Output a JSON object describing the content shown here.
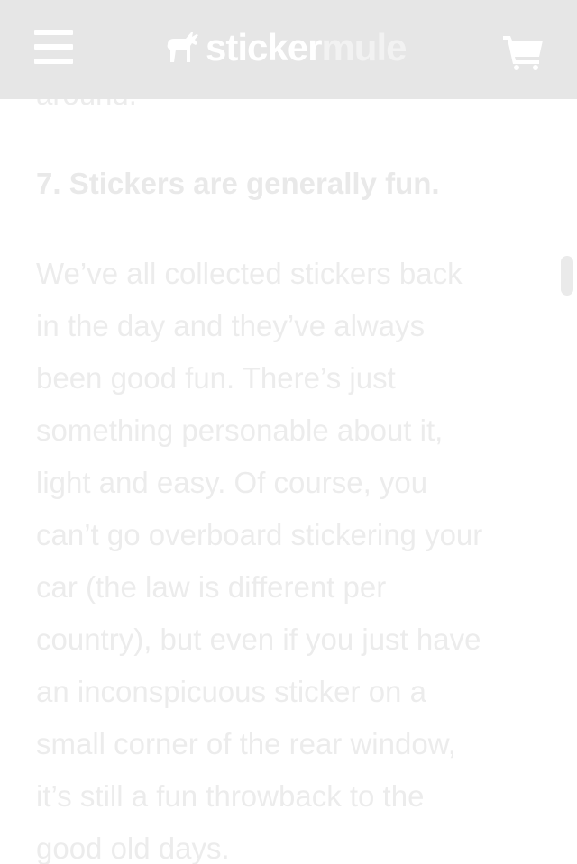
{
  "header": {
    "menu_icon": "hamburger-menu-icon",
    "logo": {
      "part1": "sticker",
      "part2": "mule",
      "icon": "mule-icon"
    },
    "cart_icon": "shopping-cart-icon"
  },
  "article": {
    "previous_fragment": "around.",
    "heading": "7. Stickers are generally fun.",
    "body_lines": [
      "We’ve all collected stickers back",
      "in the day and they’ve always",
      "been good fun. There’s just",
      "something personable about it,",
      "light and easy. Of course, you",
      "can’t go overboard stickering your",
      "car (the law is different per",
      "country), but even if you just have",
      "an inconspicuous sticker on a",
      "small corner of the rear window,",
      "it’s still a fun throwback to the",
      "good old days."
    ]
  },
  "colors": {
    "header_bg": "#e6e6e6",
    "text_faded": "#ececec",
    "logo_white": "#ffffff"
  }
}
